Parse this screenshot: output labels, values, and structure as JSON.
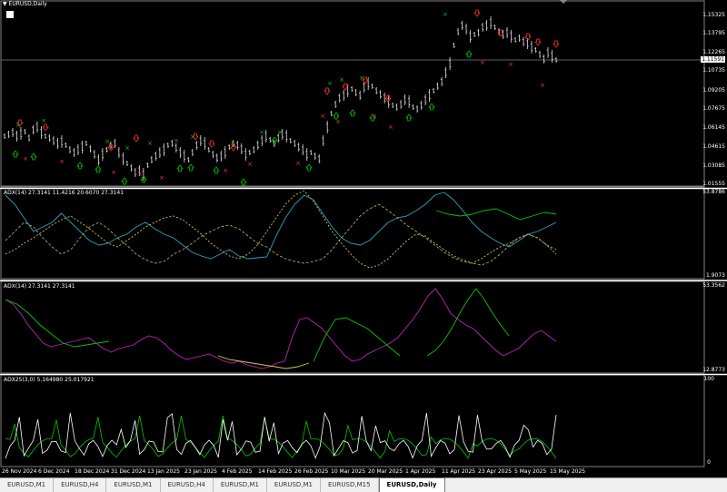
{
  "window": {
    "title": "EURUSD,Daily"
  },
  "price_axis": [
    "1.15325",
    "1.13795",
    "1.12265",
    "1.11591",
    "1.10735",
    "1.09205",
    "1.07675",
    "1.06145",
    "1.04615",
    "1.03085",
    "1.01555"
  ],
  "current_price": "1.11591",
  "panes": [
    {
      "id": "adx1",
      "label": "ADX(14) 27.3141 11.4216 20.6070 27.3141",
      "max": "53.8786",
      "min": "1.9073"
    },
    {
      "id": "adx2",
      "label": "ADX(14) 27.3141 27.3141",
      "max": "53.3562",
      "min": "12.8773"
    },
    {
      "id": "adx3",
      "label": "ADX25(3,0) 5.164980 25.017921",
      "max": "100",
      "min": "0"
    }
  ],
  "dates": [
    "26 Nov 2024",
    "6 Dec 2024",
    "18 Dec 2024",
    "31 Dec 2024",
    "13 Jan 2025",
    "23 Jan 2025",
    "4 Feb 2025",
    "14 Feb 2025",
    "26 Feb 2025",
    "10 Mar 2025",
    "20 Mar 2025",
    "1 Apr 2025",
    "11 Apr 2025",
    "23 Apr 2025",
    "5 May 2025",
    "15 May 2025"
  ],
  "tabs": [
    {
      "label": "EURUSD,M1",
      "active": false
    },
    {
      "label": "EURUSD,H4",
      "active": false
    },
    {
      "label": "EURUSD,M1",
      "active": false
    },
    {
      "label": "EURUSD,H4",
      "active": false
    },
    {
      "label": "EURUSD,M1",
      "active": false
    },
    {
      "label": "EURUSD,M1",
      "active": false
    },
    {
      "label": "EURUSD,M15",
      "active": false
    },
    {
      "label": "EURUSD,Daily",
      "active": true
    }
  ],
  "colors": {
    "grid": "#808080",
    "line": "#ffffff",
    "green": "#00c800",
    "red": "#ff3030",
    "cyan": "#2aa3c0",
    "yellow": "#d4c64a",
    "magenta": "#c020c0",
    "orange": "#ff6a00"
  }
}
